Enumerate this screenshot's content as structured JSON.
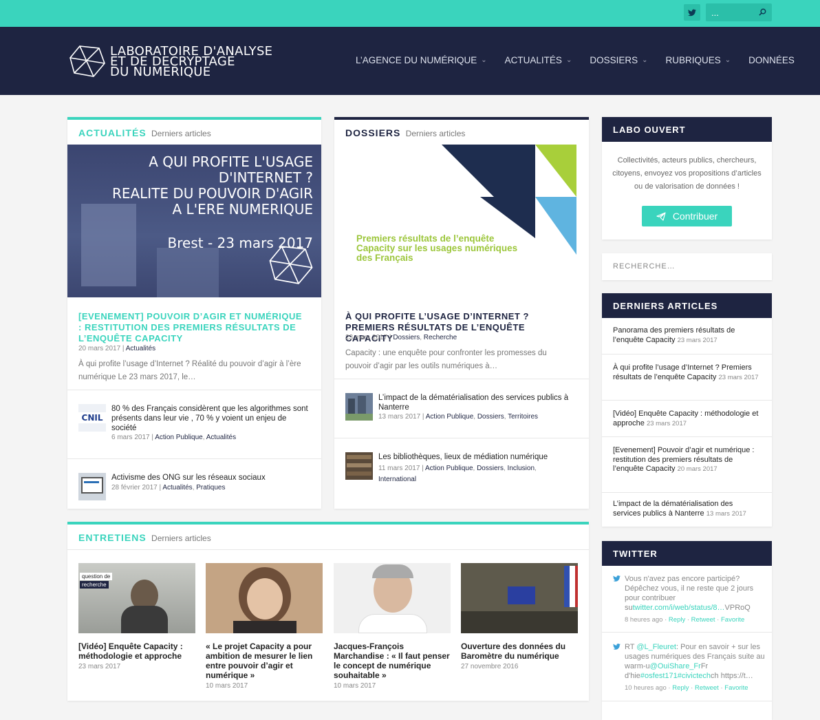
{
  "topbar": {
    "search_placeholder": "..."
  },
  "logo": {
    "line1": "LABORATOIRE D'ANALYSE",
    "line2": "ET DE DECRYPTAGE",
    "line3": "DU NUMERIQUE"
  },
  "nav": [
    {
      "label": "L’AGENCE DU NUMÉRIQUE",
      "has_dropdown": true
    },
    {
      "label": "ACTUALITÉS",
      "has_dropdown": true
    },
    {
      "label": "DOSSIERS",
      "has_dropdown": true
    },
    {
      "label": "RUBRIQUES",
      "has_dropdown": true
    },
    {
      "label": "DONNÉES",
      "has_dropdown": false
    }
  ],
  "colors": {
    "accent": "#3ad4bd",
    "navy": "#1e2441"
  },
  "actualites": {
    "category": "ACTUALITÉS",
    "subtitle": "Derniers articles",
    "banner": {
      "line1": "A QUI PROFITE L'USAGE D'INTERNET ?",
      "line2": "REALITE DU POUVOIR D'AGIR",
      "line3": "A L'ERE NUMERIQUE",
      "line4": "Brest - 23 mars 2017"
    },
    "featured": {
      "title": "[EVENEMENT] POUVOIR D’AGIR ET NUMÉRIQUE : RESTITUTION DES PREMIERS RÉSULTATS DE L’ENQUÊTE CAPACITY",
      "date": "20 mars 2017",
      "cat": "Actualités",
      "excerpt": "À qui profite l’usage d’Internet ? Réalité du pouvoir d’agir à l’ère numérique Le 23 mars 2017, le…"
    },
    "items": [
      {
        "title": "80 % des Français considèrent que les algorithmes sont présents dans leur vie , 70 % y voient un enjeu de société",
        "date": "6 mars 2017",
        "cat1": "Action Publique",
        "cat2": "Actualités",
        "thumb_text": "CNIL"
      },
      {
        "title": "Activisme des ONG sur les réseaux sociaux",
        "date": "28 février 2017",
        "cat1": "Actualités",
        "cat2": "Pratiques"
      }
    ]
  },
  "dossiers": {
    "category": "DOSSIERS",
    "subtitle": "Derniers articles",
    "banner": {
      "line1": "Premiers résultats de l’enquête",
      "line2": "Capacity sur les usages numériques",
      "line3": "des Français"
    },
    "featured": {
      "title": "À QUI PROFITE L’USAGE D’INTERNET ? PREMIERS RÉSULTATS DE L’ENQUÊTE CAPACITY",
      "date": "23 mars 2017",
      "cat1": "Dossiers",
      "cat2": "Recherche",
      "excerpt": "Capacity : une enquête pour confronter les promesses du pouvoir d’agir par les outils numériques à…"
    },
    "items": [
      {
        "title": "L’impact de la dématérialisation des services publics à Nanterre",
        "date": "13 mars 2017",
        "cat1": "Action Publique",
        "cat2": "Dossiers",
        "cat3": "Territoires"
      },
      {
        "title": "Les bibliothèques, lieux de médiation numérique",
        "date": "11 mars 2017",
        "cat1": "Action Publique",
        "cat2": "Dossiers",
        "cat3": "Inclusion",
        "cat4": "International"
      }
    ]
  },
  "entretiens": {
    "category": "ENTRETIENS",
    "subtitle": "Derniers articles",
    "items": [
      {
        "title": "[Vidéo] Enquête Capacity : méthodologie et approche",
        "date": "23 mars 2017",
        "thumb_label1": "question de",
        "thumb_label2": "recherche"
      },
      {
        "title": "« Le projet Capacity a pour ambition de mesurer le lien entre pouvoir d’agir et numérique »",
        "date": "10 mars 2017"
      },
      {
        "title": "Jacques-François Marchandise : « Il faut penser le concept de numérique souhaitable »",
        "date": "10 mars 2017"
      },
      {
        "title": "Ouverture des données du Baromètre du numérique",
        "date": "27 novembre 2016"
      }
    ]
  },
  "sidebar": {
    "labo": {
      "title": "LABO OUVERT",
      "text": "Collectivités, acteurs publics, chercheurs, citoyens, envoyez vos propositions d’articles ou de valorisation de données !",
      "button": "Contribuer"
    },
    "search_placeholder": "RECHERCHE…",
    "recent": {
      "title": "DERNIERS ARTICLES",
      "items": [
        {
          "title": "Panorama des premiers résultats de l’enquête Capacity",
          "date": "23 mars 2017"
        },
        {
          "title": "À qui profite l’usage d’Internet ? Premiers résultats de l’enquête Capacity",
          "date": "23 mars 2017"
        },
        {
          "title": "[Vidéo] Enquête Capacity : méthodologie et approche",
          "date": "23 mars 2017"
        },
        {
          "title": "[Evenement] Pouvoir d’agir et numérique : restitution des premiers résultats de l’enquête Capacity",
          "date": "20 mars 2017"
        },
        {
          "title": "L’impact de la dématérialisation des services publics à Nanterre",
          "date": "13 mars 2017"
        }
      ]
    },
    "twitter": {
      "title": "TWITTER",
      "tweets": [
        {
          "text_pre": "Vous n'avez pas encore participé? Dépêchez vous, il ne reste que 2 jours pour contribuer su",
          "link": "twitter.com/i/web/status/8…",
          "text_post": "VPRoQ",
          "time": "8 heures ago",
          "reply": "Reply",
          "retweet": "Retweet",
          "favorite": "Favorite"
        },
        {
          "rt": "RT ",
          "user": "@L_Fleuret",
          "text1": ": Pour en savoir + sur les usages numériques des Français suite au warm-u",
          "user2": "@OuiShare_Fr",
          "text2": "Fr d'hie",
          "tag1": "#osfest171",
          "tag2": "#civictech",
          "text3": "ch https://t…",
          "time": "10 heures ago",
          "reply": "Reply",
          "retweet": "Retweet",
          "favorite": "Favorite"
        }
      ]
    }
  }
}
